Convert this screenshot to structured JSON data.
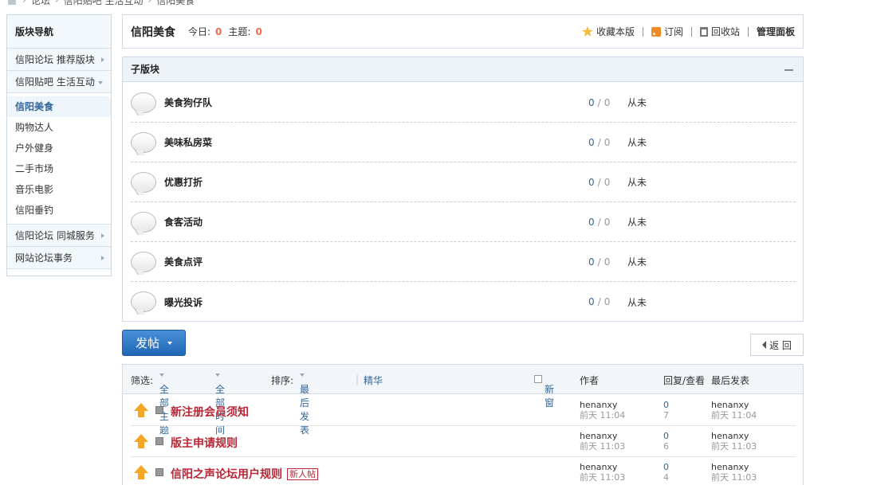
{
  "breadcrumb": [
    "论坛",
    "信阳贴吧 生活互动",
    "信阳美食"
  ],
  "sidebar": {
    "title": "版块导航",
    "cat1": "信阳论坛 推荐版块",
    "cat2": "信阳贴吧 生活互动",
    "items": [
      "信阳美食",
      "购物达人",
      "户外健身",
      "二手市场",
      "音乐电影",
      "信阳垂钓"
    ],
    "cat3": "信阳论坛 同城服务",
    "cat4": "网站论坛事务"
  },
  "header": {
    "title": "信阳美食",
    "today_label": "今日:",
    "today_value": "0",
    "topics_label": "主题:",
    "topics_value": "0",
    "favorite": "收藏本版",
    "subscribe": "订阅",
    "recycle": "回收站",
    "admin": "管理面板"
  },
  "subforums": {
    "title": "子版块",
    "rows": [
      {
        "name": "美食狗仔队",
        "threads": "0",
        "posts": "0",
        "last": "从未"
      },
      {
        "name": "美味私房菜",
        "threads": "0",
        "posts": "0",
        "last": "从未"
      },
      {
        "name": "优惠打折",
        "threads": "0",
        "posts": "0",
        "last": "从未"
      },
      {
        "name": "食客活动",
        "threads": "0",
        "posts": "0",
        "last": "从未"
      },
      {
        "name": "美食点评",
        "threads": "0",
        "posts": "0",
        "last": "从未"
      },
      {
        "name": "曝光投诉",
        "threads": "0",
        "posts": "0",
        "last": "从未"
      }
    ]
  },
  "toolbar": {
    "post_label": "发帖",
    "back_label": "返 回"
  },
  "threadlist": {
    "filter_label": "筛选:",
    "all_topics": "全部主题",
    "all_time": "全部时间",
    "sort_label": "排序:",
    "sort_value": "最后发表",
    "digest": "精华",
    "new_window": "新窗",
    "col_author": "作者",
    "col_replies": "回复/查看",
    "col_last": "最后发表",
    "rows": [
      {
        "title": "新注册会员须知",
        "tag": "",
        "author": "henanxy",
        "author_time": "前天 11:04",
        "replies": "0",
        "views": "7",
        "last_user": "henanxy",
        "last_time": "前天 11:04"
      },
      {
        "title": "版主申请规则",
        "tag": "",
        "author": "henanxy",
        "author_time": "前天 11:03",
        "replies": "0",
        "views": "6",
        "last_user": "henanxy",
        "last_time": "前天 11:03"
      },
      {
        "title": "信阳之声论坛用户规则",
        "tag": "新人帖",
        "author": "henanxy",
        "author_time": "前天 11:03",
        "replies": "0",
        "views": "4",
        "last_user": "henanxy",
        "last_time": "前天 11:03"
      }
    ]
  }
}
